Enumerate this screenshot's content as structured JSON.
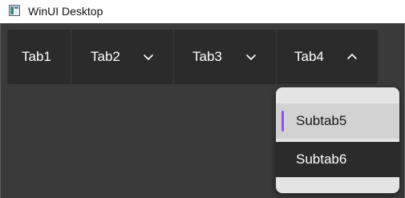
{
  "window": {
    "title": "WinUI Desktop"
  },
  "tabs": [
    {
      "label": "Tab1",
      "has_chevron": false
    },
    {
      "label": "Tab2",
      "has_chevron": true,
      "chevron": "chevron-down-icon"
    },
    {
      "label": "Tab3",
      "has_chevron": true,
      "chevron": "chevron-down-icon"
    },
    {
      "label": "Tab4",
      "has_chevron": true,
      "chevron": "chevron-up-icon",
      "expanded": true
    }
  ],
  "flyout": {
    "items": [
      {
        "label": "Subtab5",
        "selected": true
      },
      {
        "label": "Subtab6",
        "selected": false
      }
    ]
  },
  "colors": {
    "client_background": "#3a3a3a",
    "tab_background": "#2b2b2b",
    "flyout_background": "#e4e4e4",
    "selected_item_background": "#d2d2d2",
    "selection_indicator": "#8f4fff"
  }
}
